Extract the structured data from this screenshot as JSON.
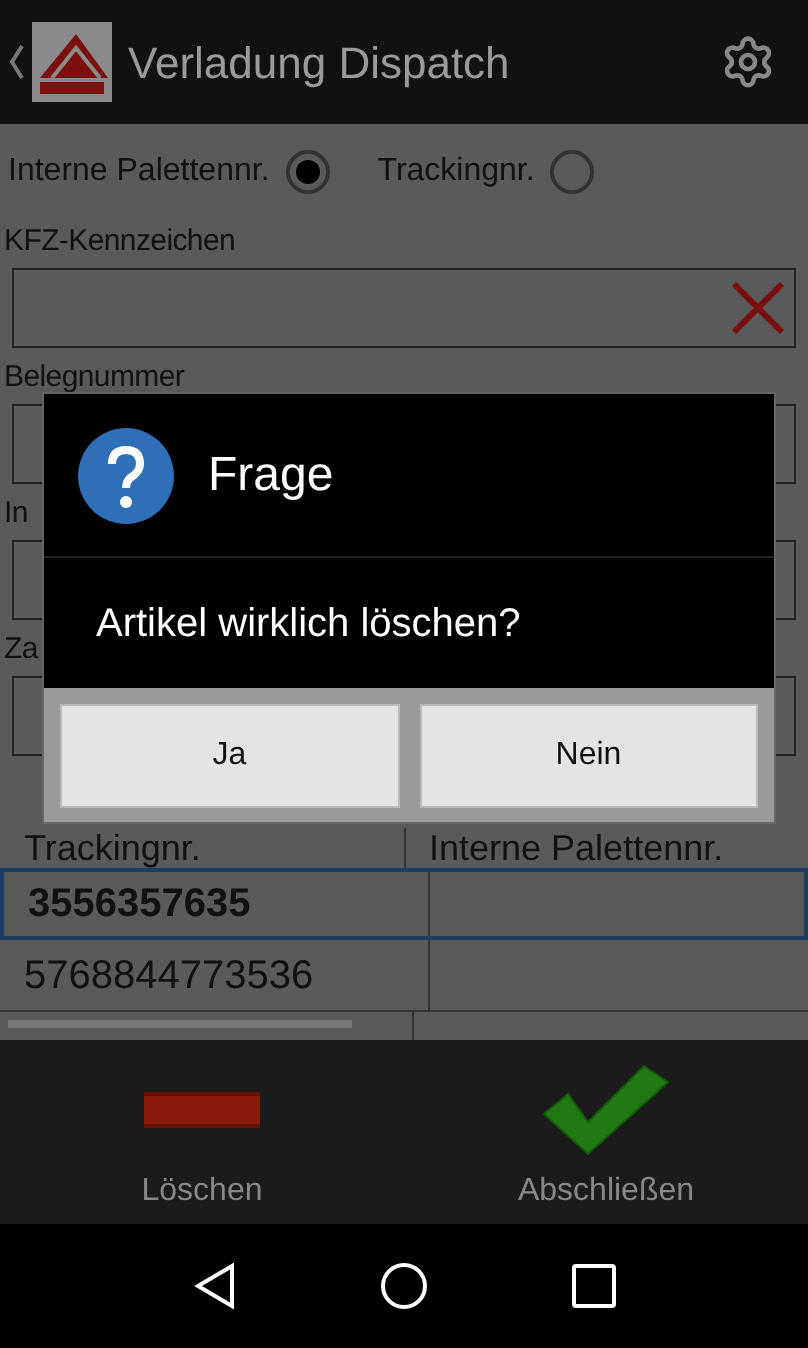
{
  "app_bar": {
    "title": "Verladung Dispatch"
  },
  "search_mode": [
    {
      "label": "Interne Palettennr.",
      "selected": true
    },
    {
      "label": "Trackingnr.",
      "selected": false
    }
  ],
  "fields": [
    {
      "label": "KFZ-Kennzeichen",
      "clearable": true
    },
    {
      "label": "Belegnummer",
      "clearable": false
    },
    {
      "label": "In",
      "clearable": false
    },
    {
      "label": "Za",
      "clearable": false
    }
  ],
  "table": {
    "columns": [
      "Trackingnr.",
      "Interne Palettennr."
    ],
    "rows": [
      {
        "tracking": "3556357635",
        "selected": true
      },
      {
        "tracking": "5768844773536",
        "selected": false
      }
    ]
  },
  "dialog": {
    "title": "Frage",
    "message": "Artikel wirklich löschen?",
    "buttons": [
      "Ja",
      "Nein"
    ]
  },
  "actions": [
    {
      "kind": "delete",
      "label": "Löschen"
    },
    {
      "kind": "confirm",
      "label": "Abschließen"
    }
  ]
}
